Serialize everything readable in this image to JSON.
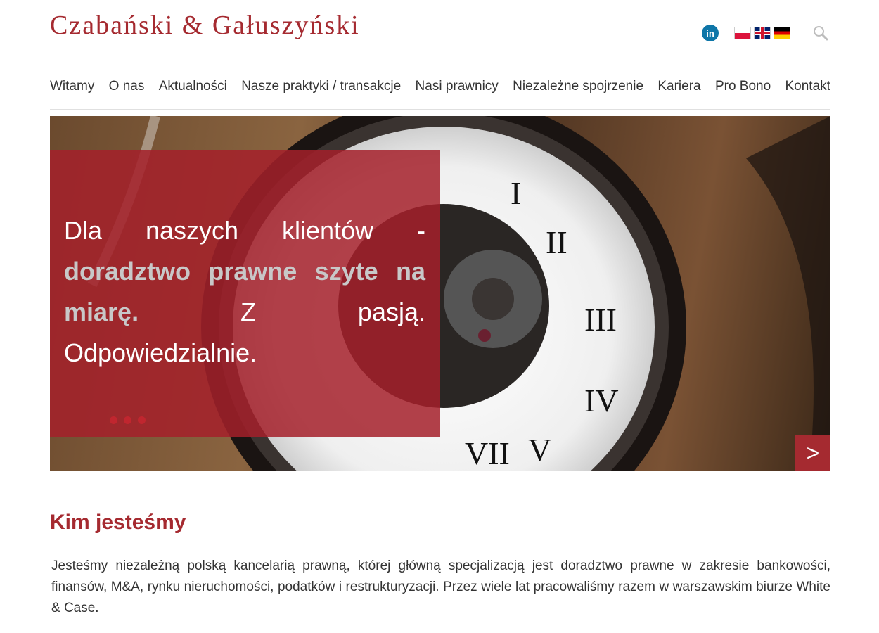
{
  "header": {
    "logo_text": "Czabański & Gałuszyński",
    "linkedin_label": "in",
    "flags": [
      {
        "name": "flag-pl-icon",
        "lang": "PL"
      },
      {
        "name": "flag-en-icon",
        "lang": "EN"
      },
      {
        "name": "flag-de-icon",
        "lang": "DE"
      }
    ]
  },
  "nav": {
    "items": [
      "Witamy",
      "O nas",
      "Aktualności",
      "Nasze praktyki / transakcje",
      "Nasi prawnicy",
      "Niezależne spojrzenie",
      "Kariera",
      "Pro Bono",
      "Kontakt"
    ]
  },
  "hero": {
    "text_1": "Dla naszych klientów - ",
    "text_highlight": "doradztwo prawne szyte na miarę.",
    "text_2": " Z pasją. Odpowiedzialnie.",
    "next_label": ">",
    "slides": 3
  },
  "content": {
    "title": "Kim jesteśmy",
    "paragraph": "Jesteśmy niezależną polską kancelarią prawną, której główną specjalizacją jest doradztwo prawne w zakresie bankowości, finansów, M&A, rynku nieruchomości, podatków i restrukturyzacji. Przez wiele lat pracowaliśmy razem w warszawskim biurze White & Case."
  },
  "colors": {
    "brand": "#a52a30",
    "linkedin": "#0e76a8"
  }
}
